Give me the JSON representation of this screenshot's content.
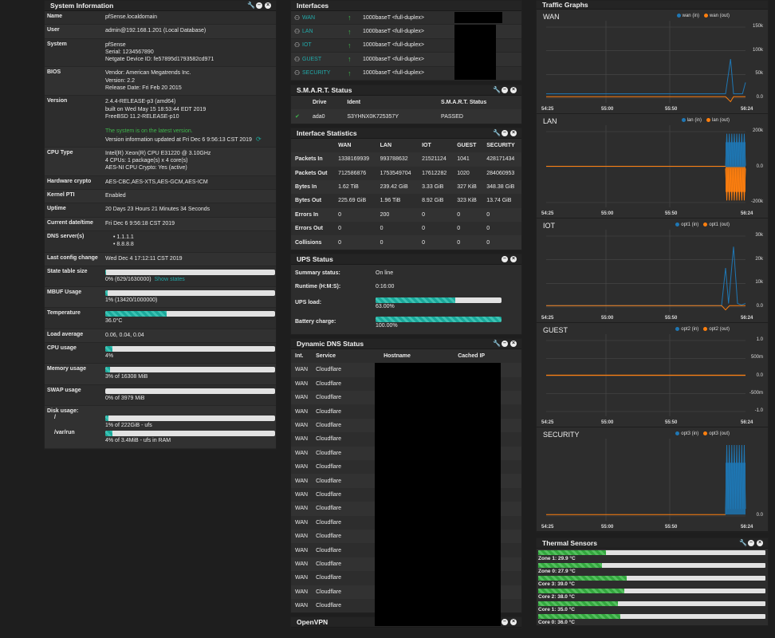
{
  "system_info": {
    "title": "System Information",
    "rows": [
      {
        "label": "Name",
        "lines": [
          "pfSense.localdomain"
        ]
      },
      {
        "label": "User",
        "lines": [
          "admin@192.168.1.201 (Local Database)"
        ]
      },
      {
        "label": "System",
        "lines": [
          "pfSense",
          "Serial: 1234567890",
          "Netgate Device ID: fe57895d1793582cd971"
        ]
      },
      {
        "label": "BIOS",
        "lines": [
          "Vendor: American Megatrends Inc.",
          "Version: 2.2",
          "Release Date: Fri Feb 20 2015"
        ]
      },
      {
        "label": "Version",
        "lines": [
          "2.4.4-RELEASE-p3 (amd64)",
          "built on Wed May 15 18:53:44 EDT 2019",
          "FreeBSD 11.2-RELEASE-p10"
        ],
        "status_green": "The system is on the latest version.",
        "status_info": "Version information updated at Fri Dec 6 9:56:13 CST 2019"
      },
      {
        "label": "CPU Type",
        "lines": [
          "Intel(R) Xeon(R) CPU E31220 @ 3.10GHz",
          "4 CPUs: 1 package(s) x 4 core(s)",
          "AES-NI CPU Crypto: Yes (active)"
        ]
      },
      {
        "label": "Hardware crypto",
        "lines": [
          "AES-CBC,AES-XTS,AES-GCM,AES-ICM"
        ]
      },
      {
        "label": "Kernel PTI",
        "lines": [
          "Enabled"
        ]
      },
      {
        "label": "Uptime",
        "lines": [
          "20 Days 23 Hours 21 Minutes 34 Seconds"
        ]
      },
      {
        "label": "Current date/time",
        "lines": [
          "Fri Dec 6 9:56:18 CST 2019"
        ]
      },
      {
        "label": "DNS server(s)",
        "dns": [
          "1.1.1.1",
          "8.8.8.8"
        ]
      },
      {
        "label": "Last config change",
        "lines": [
          "Wed Dec 4 17:12:11 CST 2019"
        ]
      }
    ],
    "state_table": {
      "label": "State table size",
      "value": 0.004,
      "text": "0% (629/1630000)",
      "link": "Show states"
    },
    "mbuf": {
      "label": "MBUF Usage",
      "value": 0.013,
      "text": "1% (13420/1000000)"
    },
    "temperature": {
      "label": "Temperature",
      "value": 0.36,
      "text": "36.0°C"
    },
    "load": {
      "label": "Load average",
      "text": "0.06, 0.04, 0.04"
    },
    "cpu": {
      "label": "CPU usage",
      "value": 0.04,
      "text": "4%"
    },
    "memory": {
      "label": "Memory usage",
      "value": 0.03,
      "text": "3% of 16308 MiB"
    },
    "swap": {
      "label": "SWAP usage",
      "value": 0.0,
      "text": "0% of 3979 MiB"
    },
    "disk": {
      "label": "Disk usage:",
      "mounts": [
        {
          "path": "/",
          "value": 0.01,
          "text": "1% of 222GiB - ufs"
        },
        {
          "path": "/var/run",
          "value": 0.04,
          "text": "4% of 3.4MiB - ufs in RAM"
        }
      ]
    }
  },
  "interfaces": {
    "title": "Interfaces",
    "rows": [
      {
        "name": "WAN",
        "media": "1000baseT <full-duplex>"
      },
      {
        "name": "LAN",
        "media": "1000baseT <full-duplex>"
      },
      {
        "name": "IOT",
        "media": "1000baseT <full-duplex>"
      },
      {
        "name": "GUEST",
        "media": "1000baseT <full-duplex>"
      },
      {
        "name": "SECURITY",
        "media": "1000baseT <full-duplex>"
      }
    ]
  },
  "smart": {
    "title": "S.M.A.R.T. Status",
    "headers": [
      "Drive",
      "Ident",
      "S.M.A.R.T. Status"
    ],
    "rows": [
      {
        "drive": "ada0",
        "ident": "S3YHNX0K725357Y",
        "status": "PASSED"
      }
    ]
  },
  "if_stats": {
    "title": "Interface Statistics",
    "headers": [
      "",
      "WAN",
      "LAN",
      "IOT",
      "GUEST",
      "SECURITY"
    ],
    "rows": [
      [
        "Packets In",
        "1338169939",
        "993788632",
        "21521124",
        "1041",
        "428171434"
      ],
      [
        "Packets Out",
        "712586876",
        "1753549704",
        "17612282",
        "1020",
        "284060953"
      ],
      [
        "Bytes In",
        "1.62 TiB",
        "239.42 GiB",
        "3.33 GiB",
        "327 KiB",
        "348.38 GiB"
      ],
      [
        "Bytes Out",
        "225.69 GiB",
        "1.96 TiB",
        "8.92 GiB",
        "323 KiB",
        "13.74 GiB"
      ],
      [
        "Errors In",
        "0",
        "200",
        "0",
        "0",
        "0"
      ],
      [
        "Errors Out",
        "0",
        "0",
        "0",
        "0",
        "0"
      ],
      [
        "Collisions",
        "0",
        "0",
        "0",
        "0",
        "0"
      ]
    ]
  },
  "ups": {
    "title": "UPS Status",
    "summary_label": "Summary status:",
    "summary": "On line",
    "runtime_label": "Runtime (H:M:S):",
    "runtime": "0:16:00",
    "load_label": "UPS load:",
    "load_value": 0.63,
    "load_text": "63.00%",
    "battery_label": "Battery charge:",
    "battery_value": 1.0,
    "battery_text": "100.00%"
  },
  "ddns": {
    "title": "Dynamic DNS Status",
    "headers": [
      "Int.",
      "Service",
      "Hostname",
      "Cached IP"
    ],
    "rows": [
      [
        "WAN",
        "Cloudflare"
      ],
      [
        "WAN",
        "Cloudflare"
      ],
      [
        "WAN",
        "Cloudflare"
      ],
      [
        "WAN",
        "Cloudflare"
      ],
      [
        "WAN",
        "Cloudflare"
      ],
      [
        "WAN",
        "Cloudflare"
      ],
      [
        "WAN",
        "Cloudflare"
      ],
      [
        "WAN",
        "Cloudflare"
      ],
      [
        "WAN",
        "Cloudflare"
      ],
      [
        "WAN",
        "Cloudflare"
      ],
      [
        "WAN",
        "Cloudflare"
      ],
      [
        "WAN",
        "Cloudflare"
      ],
      [
        "WAN",
        "Cloudflare"
      ],
      [
        "WAN",
        "Cloudflare"
      ],
      [
        "WAN",
        "Cloudflare"
      ],
      [
        "WAN",
        "Cloudflare"
      ],
      [
        "WAN",
        "Cloudflare"
      ],
      [
        "WAN",
        "Cloudflare"
      ]
    ]
  },
  "openvpn": {
    "title": "OpenVPN"
  },
  "traffic": {
    "title": "Traffic Graphs",
    "x_ticks": [
      "54:25",
      "55:00",
      "55:50",
      "56:24"
    ],
    "colors": {
      "in": "#1f77b4",
      "out": "#ff7f0e"
    },
    "graphs": [
      {
        "name": "WAN",
        "legend_in": "wan (in)",
        "legend_out": "wan (out)",
        "y_ticks": [
          "150k",
          "100k",
          "50k",
          "0.0"
        ],
        "ymin": 0,
        "ymax": 175000
      },
      {
        "name": "LAN",
        "legend_in": "lan (in)",
        "legend_out": "lan (out)",
        "y_ticks": [
          "200k",
          "0.0",
          "-200k"
        ],
        "ymin": -300000,
        "ymax": 300000
      },
      {
        "name": "IOT",
        "legend_in": "opt1 (in)",
        "legend_out": "opt1 (out)",
        "y_ticks": [
          "30k",
          "20k",
          "10k",
          "0.0"
        ],
        "ymin": 0,
        "ymax": 35000
      },
      {
        "name": "GUEST",
        "legend_in": "opt2 (in)",
        "legend_out": "opt2 (out)",
        "y_ticks": [
          "1.0",
          "500m",
          "0.0",
          "-500m",
          "-1.0"
        ],
        "ymin": -1,
        "ymax": 1
      },
      {
        "name": "SECURITY",
        "legend_in": "opt3 (in)",
        "legend_out": "opt3 (out)",
        "y_ticks": [
          "0.0"
        ],
        "ymin": 0,
        "ymax": 1
      }
    ]
  },
  "thermal": {
    "title": "Thermal Sensors",
    "sensors": [
      {
        "label": "Zone 1: 29.9 °C",
        "value": 0.299
      },
      {
        "label": "Zone 0: 27.9 °C",
        "value": 0.279
      },
      {
        "label": "Core 3: 39.0 °C",
        "value": 0.39
      },
      {
        "label": "Core 2: 38.0 °C",
        "value": 0.38
      },
      {
        "label": "Core 1: 35.0 °C",
        "value": 0.35
      },
      {
        "label": "Core 0: 36.0 °C",
        "value": 0.36
      }
    ]
  }
}
